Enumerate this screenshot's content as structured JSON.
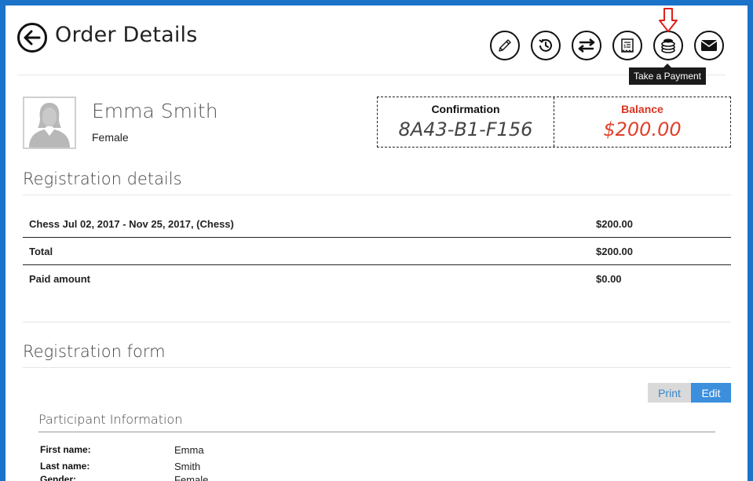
{
  "header": {
    "title": "Order Details",
    "toolbar": [
      {
        "name": "edit-button",
        "icon": "pencil-icon"
      },
      {
        "name": "history-button",
        "icon": "history-icon"
      },
      {
        "name": "transfer-button",
        "icon": "transfer-arrows-icon"
      },
      {
        "name": "invoice-button",
        "icon": "receipt-icon"
      },
      {
        "name": "take-payment-button",
        "icon": "coins-icon"
      },
      {
        "name": "email-button",
        "icon": "envelope-icon"
      }
    ],
    "tooltip": "Take a Payment"
  },
  "participant": {
    "name": "Emma Smith",
    "gender": "Female"
  },
  "summary": {
    "confirmation_label": "Confirmation",
    "confirmation_value": "8A43-B1-F156",
    "balance_label": "Balance",
    "balance_value": "$200.00",
    "balance_color": "#e0412c"
  },
  "registration_details": {
    "title": "Registration details",
    "rows": [
      {
        "description": "Chess Jul 02, 2017 - Nov 25, 2017, (Chess)",
        "amount": "$200.00"
      },
      {
        "description": "Total",
        "amount": "$200.00"
      },
      {
        "description": "Paid amount",
        "amount": "$0.00"
      }
    ]
  },
  "registration_form": {
    "title": "Registration form",
    "print_label": "Print",
    "edit_label": "Edit",
    "section_title": "Participant Information",
    "fields": [
      {
        "label": "First name:",
        "value": "Emma"
      },
      {
        "label": "Last name:",
        "value": "Smith"
      },
      {
        "label": "Gender:",
        "value": "Female"
      }
    ]
  },
  "colors": {
    "accent": "#1a73c9",
    "edit_button": "#3b8fdc",
    "annotation_arrow": "#e0201a"
  }
}
